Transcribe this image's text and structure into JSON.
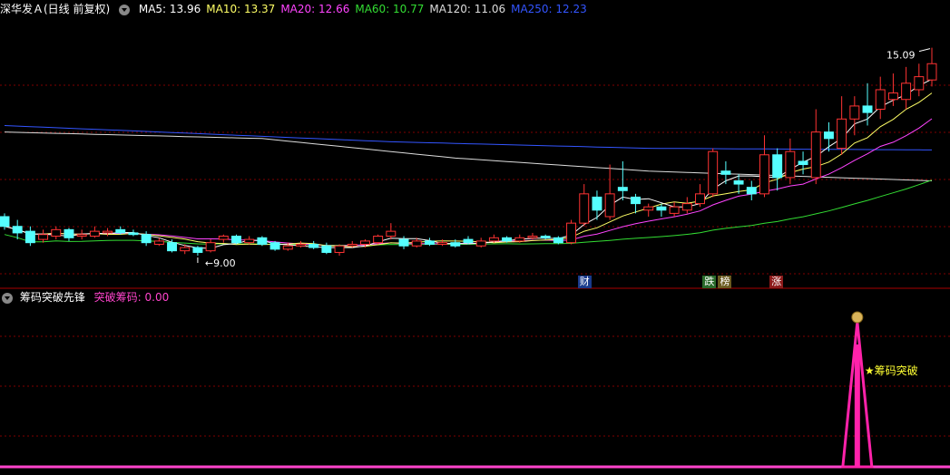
{
  "main_header": {
    "stock_title": "深华发Ａ(日线 前复权)",
    "ma": [
      {
        "label": "MA5: 13.96",
        "color": "#ffffff"
      },
      {
        "label": "MA10: 13.37",
        "color": "#ffff66"
      },
      {
        "label": "MA20: 12.66",
        "color": "#ff44ff"
      },
      {
        "label": "MA60: 10.77",
        "color": "#33dd33"
      },
      {
        "label": "MA120: 11.06",
        "color": "#dddddd"
      },
      {
        "label": "MA250: 12.23",
        "color": "#3355ff"
      }
    ]
  },
  "price_annotations": {
    "high": "15.09",
    "low": "9.00"
  },
  "event_tags": [
    {
      "text": "财",
      "bg": "#1a3a8c"
    },
    {
      "text": "跌",
      "bg": "#2a6a2a"
    },
    {
      "text": "榜",
      "bg": "#6a5a20"
    },
    {
      "text": "涨",
      "bg": "#8c1a1a"
    }
  ],
  "indicator_header": {
    "name": "筹码突破先锋",
    "series_label": "突破筹码: 0.00",
    "series_color": "#ff44cc"
  },
  "indicator_signal": {
    "label": "★筹码突破",
    "icon": "money-bag-icon"
  },
  "colors": {
    "up": "#ff3333",
    "down": "#55ffff",
    "grid": "#800000",
    "signal": "#ff22aa"
  },
  "chart_data": {
    "type": "candlestick",
    "ma_labels": [
      "MA5",
      "MA10",
      "MA20",
      "MA60",
      "MA120",
      "MA250"
    ],
    "candles": [
      [
        9.9,
        9.6,
        10.0,
        9.5
      ],
      [
        9.6,
        9.4,
        9.8,
        9.2
      ],
      [
        9.45,
        9.1,
        9.6,
        9.0
      ],
      [
        9.2,
        9.35,
        9.5,
        9.1
      ],
      [
        9.3,
        9.5,
        9.6,
        9.2
      ],
      [
        9.5,
        9.25,
        9.55,
        9.15
      ],
      [
        9.3,
        9.35,
        9.5,
        9.2
      ],
      [
        9.3,
        9.45,
        9.6,
        9.25
      ],
      [
        9.4,
        9.45,
        9.55,
        9.3
      ],
      [
        9.5,
        9.4,
        9.6,
        9.35
      ],
      [
        9.4,
        9.35,
        9.5,
        9.3
      ],
      [
        9.35,
        9.1,
        9.45,
        9.0
      ],
      [
        9.05,
        9.15,
        9.25,
        9.0
      ],
      [
        9.1,
        8.85,
        9.2,
        8.8
      ],
      [
        8.85,
        8.95,
        9.05,
        8.75
      ],
      [
        8.95,
        8.8,
        9.0,
        8.7
      ],
      [
        8.85,
        9.1,
        9.2,
        8.8
      ],
      [
        9.2,
        9.3,
        9.35,
        9.1
      ],
      [
        9.3,
        9.1,
        9.35,
        9.05
      ],
      [
        9.1,
        9.2,
        9.3,
        9.05
      ],
      [
        9.25,
        9.05,
        9.3,
        9.0
      ],
      [
        9.1,
        8.9,
        9.15,
        8.85
      ],
      [
        8.9,
        9.0,
        9.1,
        8.85
      ],
      [
        9.0,
        9.05,
        9.15,
        8.95
      ],
      [
        9.05,
        8.95,
        9.15,
        8.9
      ],
      [
        9.0,
        8.8,
        9.1,
        8.75
      ],
      [
        8.8,
        9.0,
        9.05,
        8.7
      ],
      [
        9.0,
        9.05,
        9.15,
        8.95
      ],
      [
        9.05,
        9.15,
        9.2,
        8.95
      ],
      [
        9.1,
        9.3,
        9.35,
        9.05
      ],
      [
        9.3,
        9.45,
        9.7,
        9.2
      ],
      [
        9.2,
        9.0,
        9.3,
        8.9
      ],
      [
        9.0,
        9.15,
        9.25,
        8.95
      ],
      [
        9.15,
        9.05,
        9.25,
        9.0
      ],
      [
        9.05,
        9.1,
        9.2,
        9.0
      ],
      [
        9.1,
        9.0,
        9.2,
        8.95
      ],
      [
        9.2,
        9.1,
        9.3,
        9.05
      ],
      [
        9.0,
        9.15,
        9.25,
        8.95
      ],
      [
        9.15,
        9.25,
        9.35,
        9.1
      ],
      [
        9.25,
        9.15,
        9.3,
        9.1
      ],
      [
        9.15,
        9.25,
        9.35,
        9.1
      ],
      [
        9.25,
        9.3,
        9.4,
        9.2
      ],
      [
        9.3,
        9.25,
        9.35,
        9.2
      ],
      [
        9.25,
        9.1,
        9.3,
        9.05
      ],
      [
        9.1,
        9.7,
        9.8,
        9.05
      ],
      [
        9.7,
        10.6,
        10.9,
        9.6
      ],
      [
        10.5,
        10.1,
        10.7,
        9.8
      ],
      [
        9.9,
        10.6,
        11.5,
        9.8
      ],
      [
        10.8,
        10.7,
        11.6,
        10.4
      ],
      [
        10.5,
        10.3,
        10.6,
        10.0
      ],
      [
        10.1,
        10.2,
        10.3,
        9.9
      ],
      [
        10.2,
        10.1,
        10.3,
        9.9
      ],
      [
        10.0,
        10.2,
        10.35,
        9.9
      ],
      [
        10.1,
        10.3,
        10.5,
        10.0
      ],
      [
        10.3,
        10.6,
        10.9,
        10.2
      ],
      [
        10.6,
        11.9,
        12.0,
        10.5
      ],
      [
        11.3,
        11.2,
        11.6,
        10.9
      ],
      [
        11.0,
        10.9,
        11.2,
        10.6
      ],
      [
        10.8,
        10.6,
        11.0,
        10.4
      ],
      [
        10.6,
        11.8,
        12.4,
        10.5
      ],
      [
        11.8,
        11.1,
        12.0,
        10.7
      ],
      [
        11.1,
        11.9,
        12.3,
        10.9
      ],
      [
        11.6,
        11.5,
        11.9,
        11.2
      ],
      [
        11.1,
        12.5,
        13.2,
        10.9
      ],
      [
        12.5,
        12.3,
        12.8,
        11.9
      ],
      [
        12.0,
        12.9,
        13.6,
        11.8
      ],
      [
        12.9,
        13.3,
        13.6,
        12.4
      ],
      [
        13.3,
        13.1,
        14.0,
        12.7
      ],
      [
        13.2,
        13.8,
        14.2,
        12.9
      ],
      [
        13.5,
        13.7,
        14.3,
        13.3
      ],
      [
        13.5,
        14.0,
        14.5,
        13.2
      ],
      [
        13.8,
        14.2,
        14.6,
        13.6
      ],
      [
        14.1,
        14.6,
        15.09,
        13.9
      ]
    ],
    "ma250_points": [
      [
        0,
        12.7
      ],
      [
        30,
        12.2
      ],
      [
        50,
        12.0
      ],
      [
        72,
        11.95
      ]
    ],
    "ma120_points": [
      [
        0,
        12.5
      ],
      [
        20,
        12.3
      ],
      [
        35,
        11.7
      ],
      [
        50,
        11.3
      ],
      [
        72,
        11.0
      ]
    ],
    "indicator": {
      "series": "突破筹码",
      "value": 0.0,
      "spike_index": 66
    }
  }
}
